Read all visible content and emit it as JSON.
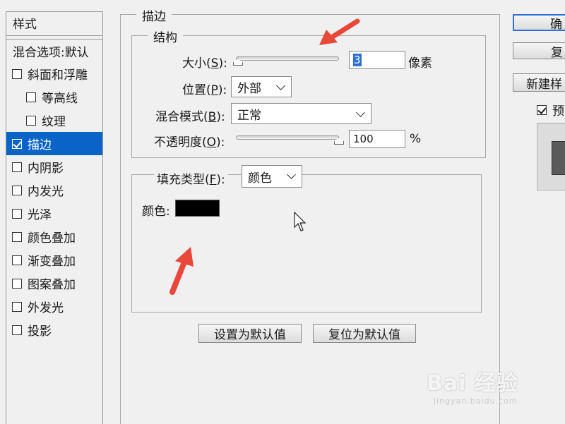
{
  "sidebar": {
    "header": "样式",
    "blend_options": "混合选项:默认",
    "items": [
      {
        "label": "斜面和浮雕",
        "checked": false,
        "sub": false,
        "active": false
      },
      {
        "label": "等高线",
        "checked": false,
        "sub": true,
        "active": false
      },
      {
        "label": "纹理",
        "checked": false,
        "sub": true,
        "active": false
      },
      {
        "label": "描边",
        "checked": true,
        "sub": false,
        "active": true
      },
      {
        "label": "内阴影",
        "checked": false,
        "sub": false,
        "active": false
      },
      {
        "label": "内发光",
        "checked": false,
        "sub": false,
        "active": false
      },
      {
        "label": "光泽",
        "checked": false,
        "sub": false,
        "active": false
      },
      {
        "label": "颜色叠加",
        "checked": false,
        "sub": false,
        "active": false
      },
      {
        "label": "渐变叠加",
        "checked": false,
        "sub": false,
        "active": false
      },
      {
        "label": "图案叠加",
        "checked": false,
        "sub": false,
        "active": false
      },
      {
        "label": "外发光",
        "checked": false,
        "sub": false,
        "active": false
      },
      {
        "label": "投影",
        "checked": false,
        "sub": false,
        "active": false
      }
    ]
  },
  "stroke": {
    "title": "描边",
    "structure": {
      "title": "结构",
      "size": {
        "label_pre": "大小(",
        "key": "S",
        "label_post": "):",
        "value": "3",
        "unit": "像素"
      },
      "position": {
        "label_pre": "位置(",
        "key": "P",
        "label_post": "):",
        "value": "外部"
      },
      "blend_mode": {
        "label_pre": "混合模式(",
        "key": "B",
        "label_post": "):",
        "value": "正常"
      },
      "opacity": {
        "label_pre": "不透明度(",
        "key": "O",
        "label_post": "):",
        "value": "100",
        "unit": "%",
        "percent": 100
      }
    },
    "fill": {
      "type_label_pre": "填充类型(",
      "type_key": "F",
      "type_label_post": "):",
      "type_value": "颜色",
      "color_label": "颜色:",
      "color": "#000000"
    },
    "buttons": {
      "set_default": "设置为默认值",
      "reset_default": "复位为默认值"
    }
  },
  "right_panel": {
    "ok": "确",
    "reset": "复",
    "new_style": "新建样",
    "preview_label": "预",
    "preview_checked": true
  },
  "watermark": {
    "main": "Bai  经验",
    "sub": "jingyan.baidu.com"
  },
  "colors": {
    "accent": "#0a64c8",
    "arrow": "#e8473a"
  }
}
